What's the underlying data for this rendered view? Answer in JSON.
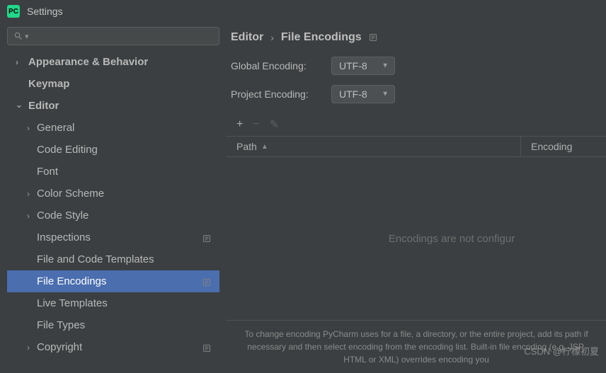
{
  "titlebar": {
    "title": "Settings",
    "app_icon_text": "PC"
  },
  "sidebar": {
    "items": [
      {
        "label": "Appearance & Behavior",
        "level": 1,
        "expandable": true,
        "expanded": false
      },
      {
        "label": "Keymap",
        "level": 1,
        "expandable": false
      },
      {
        "label": "Editor",
        "level": 1,
        "expandable": true,
        "expanded": true
      },
      {
        "label": "General",
        "level": 2,
        "expandable": true,
        "expanded": false
      },
      {
        "label": "Code Editing",
        "level": 2,
        "expandable": false
      },
      {
        "label": "Font",
        "level": 2,
        "expandable": false
      },
      {
        "label": "Color Scheme",
        "level": 2,
        "expandable": true,
        "expanded": false
      },
      {
        "label": "Code Style",
        "level": 2,
        "expandable": true,
        "expanded": false
      },
      {
        "label": "Inspections",
        "level": 2,
        "expandable": false,
        "badge": true
      },
      {
        "label": "File and Code Templates",
        "level": 2,
        "expandable": false
      },
      {
        "label": "File Encodings",
        "level": 2,
        "expandable": false,
        "badge": true,
        "selected": true
      },
      {
        "label": "Live Templates",
        "level": 2,
        "expandable": false
      },
      {
        "label": "File Types",
        "level": 2,
        "expandable": false
      },
      {
        "label": "Copyright",
        "level": 2,
        "expandable": true,
        "expanded": false,
        "badge": true
      }
    ]
  },
  "breadcrumb": {
    "root": "Editor",
    "leaf": "File Encodings",
    "sep": "›"
  },
  "fields": {
    "global_label": "Global Encoding:",
    "global_value": "UTF-8",
    "project_label": "Project Encoding:",
    "project_value": "UTF-8"
  },
  "toolbar": {
    "add": "+",
    "remove": "−",
    "edit": "✎"
  },
  "table": {
    "col_path": "Path",
    "col_encoding": "Encoding",
    "empty_text": "Encodings are not configur"
  },
  "footer_note": "To change encoding PyCharm uses for a file, a directory, or the entire project, add its path if necessary and then select encoding from the encoding list. Built-in file encoding (e.g. JSP, HTML or XML) overrides encoding you",
  "watermark": "CSDN @柠檬初夏"
}
